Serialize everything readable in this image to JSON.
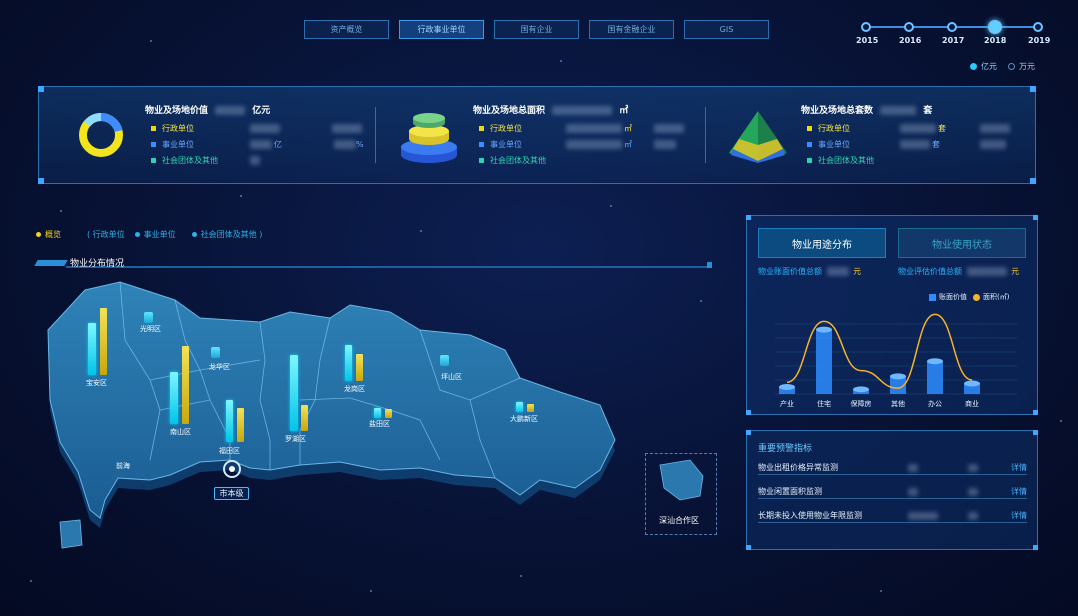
{
  "top_nav": {
    "tabs": [
      {
        "label": "资产概览",
        "active": false
      },
      {
        "label": "行政事业单位",
        "active": true
      },
      {
        "label": "国有企业",
        "active": false
      },
      {
        "label": "国有金融企业",
        "active": false
      },
      {
        "label": "GIS",
        "active": false
      }
    ]
  },
  "timeline": {
    "years": [
      "2015",
      "2016",
      "2017",
      "2018",
      "2019"
    ],
    "selected": "2018"
  },
  "unit_toggle": {
    "options": [
      "亿元",
      "万元"
    ],
    "selected": "亿元"
  },
  "summary": {
    "value": {
      "title": "物业及场地价值",
      "unit": "亿元",
      "rows": [
        {
          "label": "行政单位",
          "unit": "",
          "pct": ""
        },
        {
          "label": "事业单位",
          "unit": "亿",
          "pct": "%"
        },
        {
          "label": "社会团体及其他",
          "unit": "",
          "pct": ""
        }
      ]
    },
    "area": {
      "title": "物业及场地总面积",
      "unit": "㎡",
      "rows": [
        {
          "label": "行政单位",
          "unit": "㎡",
          "pct": ""
        },
        {
          "label": "事业单位",
          "unit": "㎡",
          "pct": ""
        },
        {
          "label": "社会团体及其他",
          "unit": "",
          "pct": ""
        }
      ]
    },
    "count": {
      "title": "物业及场地总套数",
      "unit": "套",
      "rows": [
        {
          "label": "行政单位",
          "unit": "套",
          "pct": ""
        },
        {
          "label": "事业单位",
          "unit": "套",
          "pct": ""
        },
        {
          "label": "社会团体及其他",
          "unit": "",
          "pct": ""
        }
      ]
    },
    "colors": {
      "admin": "#e8d81c",
      "institution": "#3f8cff",
      "social": "#2fd3b3"
    }
  },
  "category_legend": {
    "items": [
      "概览",
      "( 行政单位",
      "事业单位",
      "社会团体及其他 )"
    ]
  },
  "map": {
    "title": "物业分布情况",
    "regions": [
      {
        "name": "光明区"
      },
      {
        "name": "宝安区"
      },
      {
        "name": "龙华区"
      },
      {
        "name": "南山区"
      },
      {
        "name": "福田区"
      },
      {
        "name": "罗湖区"
      },
      {
        "name": "龙岗区"
      },
      {
        "name": "坪山区"
      },
      {
        "name": "盐田区"
      },
      {
        "name": "大鹏新区"
      },
      {
        "name": "前海"
      }
    ],
    "city_button": "市本级",
    "inset_label": "深汕合作区"
  },
  "usage_panel": {
    "tab_active": "物业用途分布",
    "tab_inactive": "物业使用状态",
    "sub_left": "物业账面价值总额",
    "sub_left_unit": "元",
    "sub_right": "物业评估价值总额",
    "sub_right_unit": "元",
    "legend_value": "账面价值",
    "legend_area": "面积(㎡)"
  },
  "chart_data": {
    "type": "bar",
    "categories": [
      "产业",
      "住宅",
      "保障房",
      "其他",
      "办公",
      "商业"
    ],
    "series": [
      {
        "name": "账面价值",
        "values": [
          6,
          55,
          4,
          15,
          28,
          9
        ]
      },
      {
        "name": "面积(㎡)",
        "values": [
          10,
          62,
          20,
          5,
          68,
          12
        ]
      }
    ],
    "title": "",
    "xlabel": "",
    "ylabel": "",
    "colors": [
      "#2e8cff",
      "#f6b22a"
    ]
  },
  "warnings": {
    "title": "重要预警指标",
    "rows": [
      {
        "label": "物业出租价格异常监测",
        "link": "详情"
      },
      {
        "label": "物业闲置面积监测",
        "link": "详情"
      },
      {
        "label": "长期未投入使用物业年限监测",
        "link": "详情"
      }
    ]
  }
}
